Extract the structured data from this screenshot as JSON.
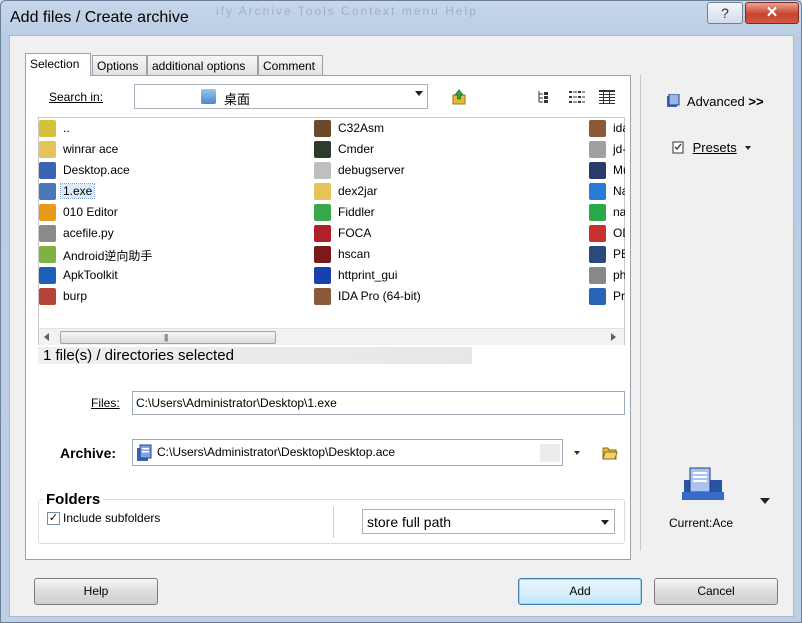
{
  "window": {
    "title": "Add files / Create archive",
    "ghost_menu": "ify  Archive  Tools  Context menu  Help",
    "help_glyph": "?",
    "close_glyph": "✕"
  },
  "tabs": [
    {
      "label": "Selection",
      "active": true
    },
    {
      "label": "Options",
      "active": false
    },
    {
      "label": "additional options",
      "active": false
    },
    {
      "label": "Comment",
      "active": false
    }
  ],
  "search": {
    "label": "Search in:",
    "value": "桌面",
    "up_icon": "up-folder-icon"
  },
  "view_icons": [
    "tree-view-icon",
    "list-view-icon",
    "details-view-icon"
  ],
  "files": {
    "col1": [
      {
        "name": "..",
        "icon": "parent-dir-icon",
        "color": "#d4c23a",
        "selected": false
      },
      {
        "name": "winrar ace",
        "icon": "folder-icon",
        "color": "#e6c25a",
        "selected": false
      },
      {
        "name": "Desktop.ace",
        "icon": "ace-archive-icon",
        "color": "#3a62b5",
        "selected": false
      },
      {
        "name": "1.exe",
        "icon": "exe-icon",
        "color": "#4a78b8",
        "selected": true
      },
      {
        "name": "010 Editor",
        "icon": "010-editor-icon",
        "color": "#e89a1f",
        "selected": false
      },
      {
        "name": "acefile.py",
        "icon": "python-file-icon",
        "color": "#8a8a8a",
        "selected": false
      },
      {
        "name": "Android逆向助手",
        "icon": "android-icon",
        "color": "#7cb342",
        "selected": false
      },
      {
        "name": "ApkToolkit",
        "icon": "apk-icon",
        "color": "#1e5fb8",
        "selected": false
      },
      {
        "name": "burp",
        "icon": "burp-icon",
        "color": "#b5453a",
        "selected": false
      }
    ],
    "col2": [
      {
        "name": "C32Asm",
        "icon": "c32asm-icon",
        "color": "#6a4a2a",
        "selected": false
      },
      {
        "name": "Cmder",
        "icon": "cmder-icon",
        "color": "#2c3b2c",
        "selected": false
      },
      {
        "name": "debugserver",
        "icon": "file-icon",
        "color": "#bfbfbf",
        "selected": false
      },
      {
        "name": "dex2jar",
        "icon": "folder-icon",
        "color": "#e6c25a",
        "selected": false
      },
      {
        "name": "Fiddler",
        "icon": "fiddler-icon",
        "color": "#3aa84a",
        "selected": false
      },
      {
        "name": "FOCA",
        "icon": "foca-icon",
        "color": "#b0202a",
        "selected": false
      },
      {
        "name": "hscan",
        "icon": "hscan-icon",
        "color": "#7a1a1a",
        "selected": false
      },
      {
        "name": "httprint_gui",
        "icon": "httprint-icon",
        "color": "#1a3fb0",
        "selected": false
      },
      {
        "name": "IDA Pro (64-bit)",
        "icon": "ida-icon",
        "color": "#8a5a3a",
        "selected": false
      }
    ],
    "col3": [
      {
        "name": "ida",
        "icon": "ida-icon",
        "color": "#8a5a3a"
      },
      {
        "name": "jd-",
        "icon": "jd-gui-icon",
        "color": "#a0a0a0"
      },
      {
        "name": "Mu",
        "icon": "mu-icon",
        "color": "#2a3a6a"
      },
      {
        "name": "Na",
        "icon": "navicat-icon",
        "color": "#2a7ad8"
      },
      {
        "name": "na",
        "icon": "na-icon",
        "color": "#2aa84a"
      },
      {
        "name": "OD",
        "icon": "ollydbg-icon",
        "color": "#c83030"
      },
      {
        "name": "PE",
        "icon": "pe-icon",
        "color": "#2a4a7a"
      },
      {
        "name": "ph",
        "icon": "ph-icon",
        "color": "#888888"
      },
      {
        "name": "Pro",
        "icon": "pro-icon",
        "color": "#2a62b5"
      }
    ]
  },
  "scrollbar": {
    "grip": "|||"
  },
  "status": "1 file(s) / directories selected",
  "files_field": {
    "label": "Files:",
    "value": "C:\\Users\\Administrator\\Desktop\\1.exe"
  },
  "archive_field": {
    "label": "Archive:",
    "value": "C:\\Users\\Administrator\\Desktop\\Desktop.ace"
  },
  "folders": {
    "title": "Folders",
    "include_label": "Include subfolders",
    "include_checked": "✓",
    "path_mode": "store full path"
  },
  "side": {
    "advanced_label": "Advanced",
    "advanced_suffix": ">>",
    "presets_label": "Presets",
    "current_label": "Current:Ace"
  },
  "buttons": {
    "help": "Help",
    "add": "Add",
    "cancel": "Cancel"
  }
}
